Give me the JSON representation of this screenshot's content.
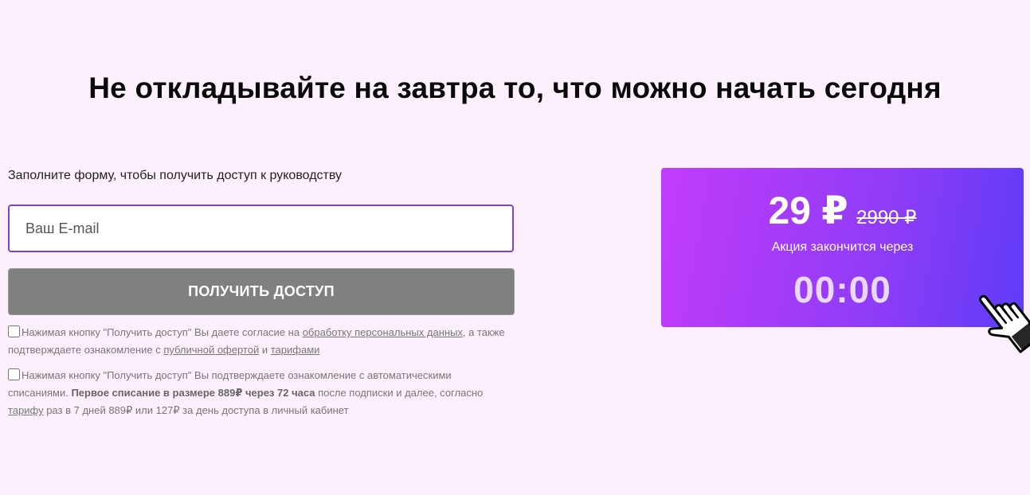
{
  "headline": "Не откладывайте на завтра то, что можно начать сегодня",
  "form": {
    "intro": "Заполните форму, чтобы получить доступ к руководству",
    "email_placeholder": "Ваш E-mail",
    "email_value": "",
    "submit_label": "ПОЛУЧИТЬ ДОСТУП"
  },
  "consent_1": {
    "text_before": "Нажимая кнопку \"Получить доступ\" Вы даете согласие на ",
    "link_personal_data": "обработку персональных данных",
    "text_middle": ", а также подтверждаете ознакомление с ",
    "link_offer": "публичной офертой",
    "text_and": " и ",
    "link_tariffs": "тарифами",
    "checked": false
  },
  "consent_2": {
    "text_before": "Нажимая кнопку \"Получить доступ\" Вы подтверждаете ознакомление с автоматическими списаниями. ",
    "bold_text": "Первое списание в размере 889₽ через 72 часа",
    "text_middle": " после подписки и далее, согласно ",
    "link_tariff": "тарифу",
    "text_after": " раз в 7 дней 889₽ или 127₽ за день доступа в личный кабинет",
    "checked": false
  },
  "promo": {
    "price_new": "29 ₽",
    "price_old": "2990 ₽",
    "label": "Акция закончится через",
    "timer": "00:00"
  },
  "colors": {
    "background": "#fdf0fd",
    "accent_border": "#7d3ee0",
    "button_disabled": "#808080",
    "promo_gradient_start": "#c23cfb",
    "promo_gradient_end": "#5e3cf7",
    "timer": "#ead9ff"
  },
  "icons": {
    "cursor": "hand-pointer-icon"
  }
}
